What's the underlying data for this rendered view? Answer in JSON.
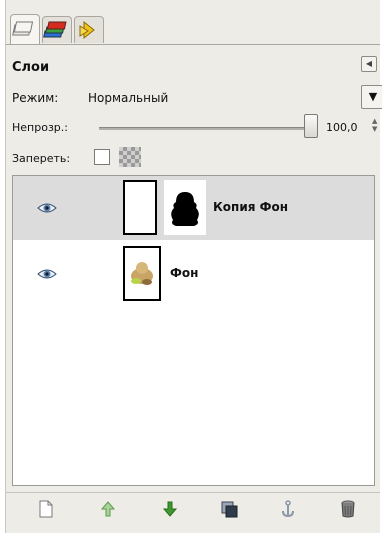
{
  "panel": {
    "title": "Слои",
    "mode_label": "Режим:",
    "mode_value": "Нормальный",
    "opacity_label": "Непрозр.:",
    "opacity_value": "100,0",
    "opacity_fraction": 1.0,
    "lock_label": "Запереть:"
  },
  "tabs": [
    {
      "icon": "layers-icon"
    },
    {
      "icon": "channels-icon"
    },
    {
      "icon": "undo-history-icon"
    }
  ],
  "layers": [
    {
      "name": "Копия Фон",
      "visible": true,
      "selected": true,
      "has_mask": true
    },
    {
      "name": "Фон",
      "visible": true,
      "selected": false,
      "has_mask": false
    }
  ],
  "toolbar": [
    {
      "icon": "new-layer-icon"
    },
    {
      "icon": "raise-layer-icon"
    },
    {
      "icon": "lower-layer-icon"
    },
    {
      "icon": "duplicate-layer-icon"
    },
    {
      "icon": "anchor-layer-icon"
    },
    {
      "icon": "delete-layer-icon"
    }
  ],
  "colors": {
    "accent_green": "#3f9a2e",
    "tab_red": "#d62b1f",
    "selection": "#dcdcdc"
  }
}
